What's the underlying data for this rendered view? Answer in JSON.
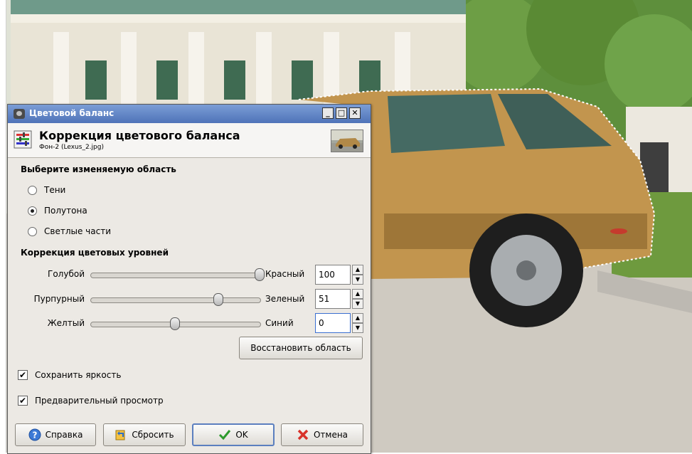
{
  "dialog": {
    "title": "Цветовой баланс",
    "heading": "Коррекция цветового баланса",
    "subheading": "Фон-2 (Lexus_2.jpg)"
  },
  "range": {
    "label": "Выберите изменяемую область",
    "options": [
      {
        "label": "Тени",
        "selected": false
      },
      {
        "label": "Полутона",
        "selected": true
      },
      {
        "label": "Светлые части",
        "selected": false
      }
    ]
  },
  "levels": {
    "label": "Коррекция цветовых уровней",
    "sliders": [
      {
        "left": "Голубой",
        "right": "Красный",
        "value": "100",
        "fraction": 1.0
      },
      {
        "left": "Пурпурный",
        "right": "Зеленый",
        "value": "51",
        "fraction": 0.755
      },
      {
        "left": "Желтый",
        "right": "Синий",
        "value": "0",
        "fraction": 0.5
      }
    ]
  },
  "buttons": {
    "reset_range": "Восстановить область",
    "help": "Справка",
    "reset": "Сбросить",
    "ok": "OK",
    "cancel": "Отмена"
  },
  "options": {
    "preserve_luminosity": "Сохранить яркость",
    "preview": "Предварительный просмотр"
  },
  "colors": {
    "titlebar": "#5a7cc0",
    "car": "#c2954e"
  },
  "icons": [
    "app-icon",
    "color-balance-icon",
    "help-icon",
    "reset-icon",
    "ok-check-icon",
    "cancel-x-icon"
  ]
}
